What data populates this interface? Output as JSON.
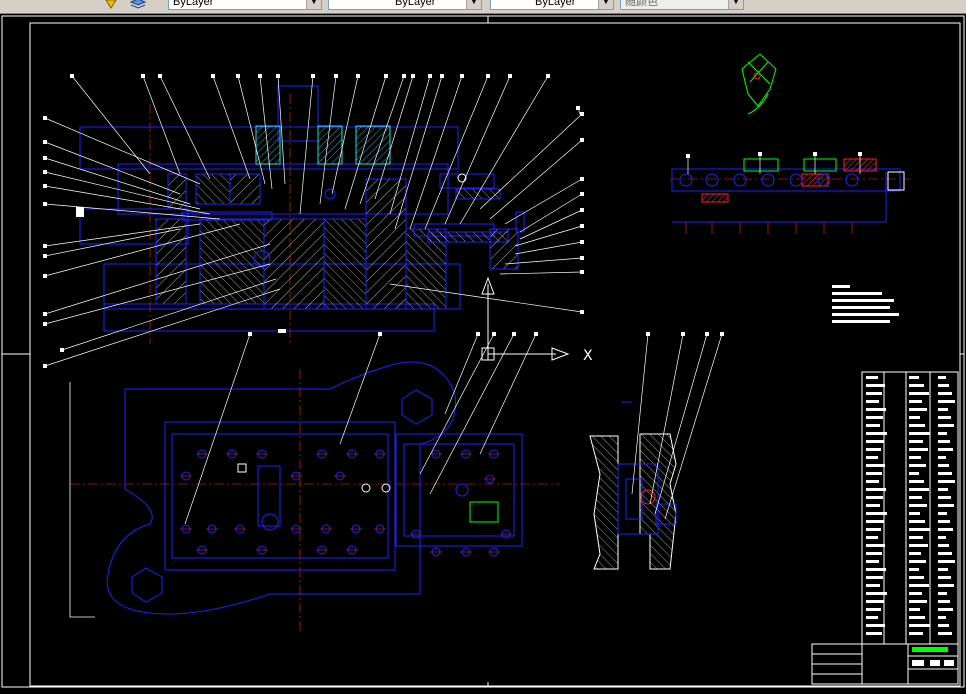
{
  "toolbar": {
    "layer_combo_1": "ByLayer",
    "layer_combo_2": "ByLayer",
    "layer_combo_3": "ByLayer",
    "color_combo": "随颜色"
  },
  "drawing": {
    "ucs_x_label": "X",
    "colors": {
      "frame": "#ffffff",
      "geometry": "#2020ff",
      "hatch": "#ffffff",
      "centerline": "#ff2020",
      "leader": "#ffffff",
      "accent_green": "#00ff00",
      "accent_red": "#ff2020"
    }
  }
}
